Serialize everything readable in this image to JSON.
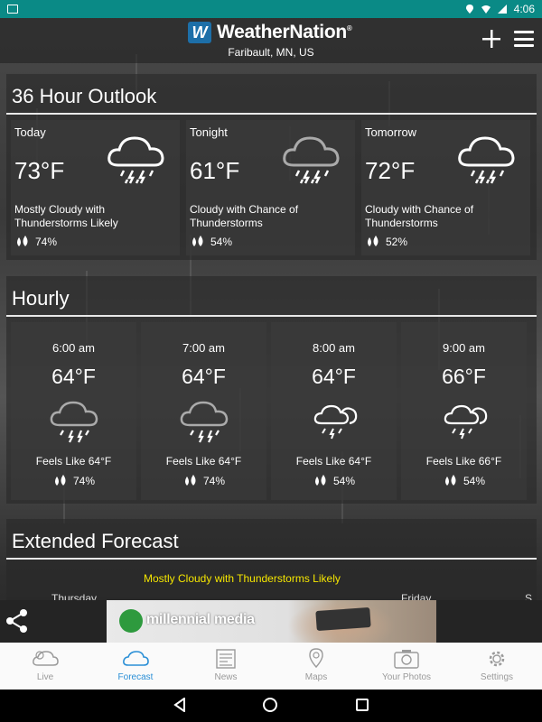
{
  "status_bar": {
    "time": "4:06"
  },
  "header": {
    "brand": "WeatherNation",
    "brand_mark": "W",
    "location": "Faribault, MN, US"
  },
  "outlook": {
    "title": "36 Hour Outlook",
    "cards": [
      {
        "label": "Today",
        "temp": "73°F",
        "condition": "Mostly Cloudy with Thunderstorms Likely",
        "precip": "74%",
        "icon": "thunderstorm-cloud-icon"
      },
      {
        "label": "Tonight",
        "temp": "61°F",
        "condition": "Cloudy with Chance of Thunderstorms",
        "precip": "54%",
        "icon": "thunderstorm-cloud-icon"
      },
      {
        "label": "Tomorrow",
        "temp": "72°F",
        "condition": "Cloudy with Chance of Thunderstorms",
        "precip": "52%",
        "icon": "thunderstorm-cloud-icon"
      }
    ]
  },
  "hourly": {
    "title": "Hourly",
    "cards": [
      {
        "time": "6:00 am",
        "temp": "64°F",
        "feels": "Feels Like 64°F",
        "precip": "74%",
        "icon": "thunderstorm-cloud-icon"
      },
      {
        "time": "7:00 am",
        "temp": "64°F",
        "feels": "Feels Like 64°F",
        "precip": "74%",
        "icon": "thunderstorm-cloud-icon"
      },
      {
        "time": "8:00 am",
        "temp": "64°F",
        "feels": "Feels Like 64°F",
        "precip": "54%",
        "icon": "storm-clouds-icon"
      },
      {
        "time": "9:00 am",
        "temp": "66°F",
        "feels": "Feels Like 66°F",
        "precip": "54%",
        "icon": "storm-clouds-icon"
      }
    ]
  },
  "extended": {
    "title": "Extended Forecast",
    "condition": "Mostly Cloudy with Thunderstorms Likely",
    "days": [
      "Thursday",
      "Friday",
      "S"
    ]
  },
  "ad": {
    "text": "millennial media"
  },
  "nav": {
    "items": [
      {
        "label": "Live",
        "icon": "live-cloud-icon"
      },
      {
        "label": "Forecast",
        "icon": "forecast-cloud-icon"
      },
      {
        "label": "News",
        "icon": "news-icon"
      },
      {
        "label": "Maps",
        "icon": "map-pin-icon"
      },
      {
        "label": "Your Photos",
        "icon": "camera-icon"
      },
      {
        "label": "Settings",
        "icon": "gear-icon"
      }
    ],
    "active": "Forecast"
  },
  "colors": {
    "status_bar": "#0a8a86",
    "accent": "#2a8fd6",
    "extended_condition": "#f5e600",
    "brand_mark": "#1d6fa8"
  }
}
